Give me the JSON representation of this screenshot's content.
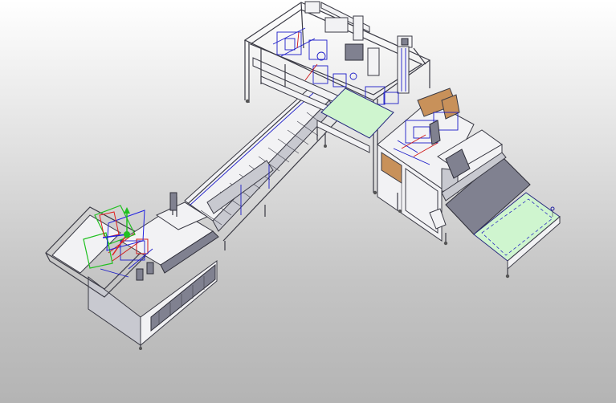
{
  "viewport": {
    "name": "cad-3d-viewport",
    "background_top": "#ffffff",
    "background_bottom": "#b4b4b4"
  },
  "model": {
    "edge_color": "#3a3a44",
    "highlight_color": "#1c1cc8",
    "conveyor_green": "#cff5cf",
    "panel_brown": "#c8915a",
    "triad_x_color": "#e02020",
    "triad_y_color": "#20c020",
    "triad_z_color": "#2020e0"
  }
}
